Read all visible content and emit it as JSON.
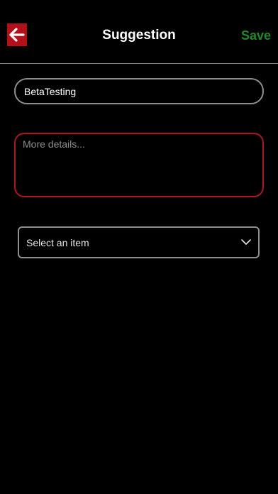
{
  "header": {
    "title": "Suggestion",
    "save_label": "Save",
    "back_icon": "arrow-left-icon"
  },
  "form": {
    "subject_value": "BetaTesting",
    "details_placeholder": "More details...",
    "select_value": "Select an item",
    "select_icon": "chevron-down-icon"
  },
  "colors": {
    "background": "#000000",
    "accent_red": "#b3101a",
    "save_green": "#1f8a1f",
    "border_gray": "#8e8e8e"
  }
}
